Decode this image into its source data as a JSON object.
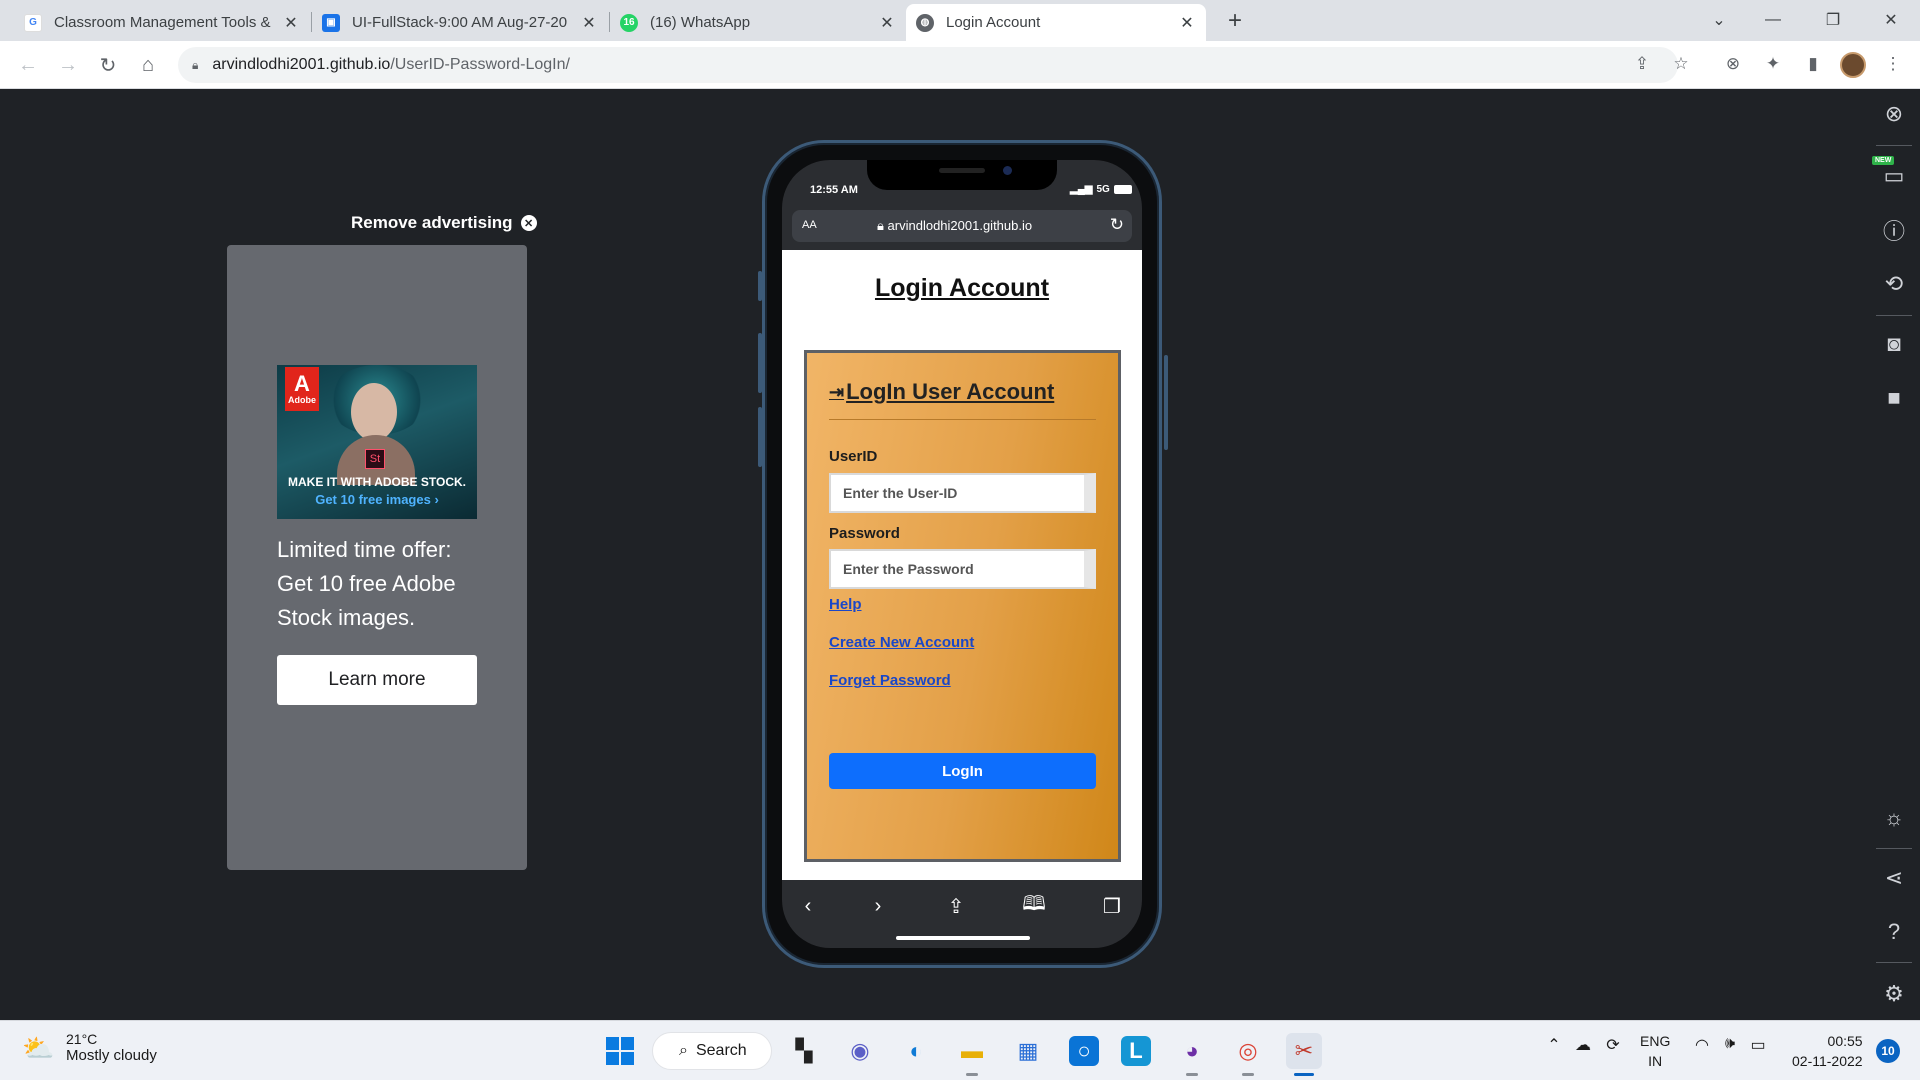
{
  "browser": {
    "tabs": [
      {
        "title": "Classroom Management Tools &",
        "favicon": "google-icon",
        "active": false
      },
      {
        "title": "UI-FullStack-9:00 AM Aug-27-20",
        "favicon": "classroom-icon",
        "active": false
      },
      {
        "title": "(16) WhatsApp",
        "favicon": "whatsapp-icon",
        "active": false
      },
      {
        "title": "Login Account",
        "favicon": "globe-icon",
        "active": true
      }
    ],
    "url_host": "arvindlodhi2001.github.io",
    "url_path": "/UserID-Password-LogIn/"
  },
  "ad": {
    "remove_label": "Remove advertising",
    "image_tagline": "MAKE IT WITH ADOBE STOCK.",
    "image_sub": "Get 10 free images ›",
    "logo_text": "Adobe",
    "logo_letter": "A",
    "product_badge": "St",
    "offer_text": "Limited time offer: Get 10 free Adobe Stock images.",
    "cta_label": "Learn more"
  },
  "phone": {
    "time": "12:55 AM",
    "network": "5G",
    "text_size_label": "AA",
    "domain": "arvindlodhi2001.github.io",
    "page": {
      "title": "Login Account",
      "card_heading": "LogIn User Account",
      "userid_label": "UserID",
      "userid_placeholder": "Enter the User-ID",
      "password_label": "Password",
      "password_placeholder": "Enter the Password",
      "help_link": "Help",
      "create_link": "Create New Account",
      "forget_link": "Forget Password",
      "login_button": "LogIn"
    }
  },
  "devtools_panel": {
    "new_badge": "NEW",
    "icons": [
      "close-icon",
      "responsive-devices-icon",
      "info-icon",
      "rotate-icon",
      "camera-icon",
      "video-icon",
      "brightness-icon",
      "share-icon",
      "help-icon",
      "settings-icon"
    ]
  },
  "taskbar": {
    "temperature": "21°C",
    "weather": "Mostly cloudy",
    "search_label": "Search",
    "lang_top": "ENG",
    "lang_bottom": "IN",
    "time": "00:55",
    "date": "02-11-2022",
    "notification_count": "10"
  },
  "colors": {
    "page_bg": "#1f2226",
    "card_gradient_start": "#f1b567",
    "card_gradient_end": "#d08719",
    "login_button": "#0d6efd",
    "link": "#1a47c8"
  }
}
